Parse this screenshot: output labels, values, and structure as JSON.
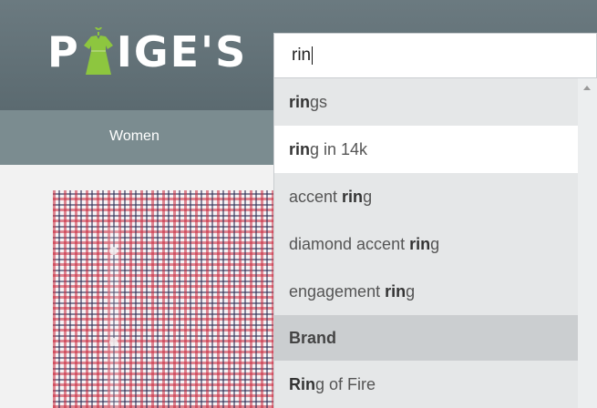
{
  "logo": {
    "prefix": "P",
    "suffix": "IGE'S"
  },
  "nav": {
    "items": [
      {
        "label": "Women"
      }
    ]
  },
  "search": {
    "value": "rin"
  },
  "dropdown": {
    "suggestions": [
      {
        "bold": "rin",
        "rest": "gs"
      },
      {
        "bold": "rin",
        "rest": "g in 14k"
      },
      {
        "pre": "accent ",
        "bold": "rin",
        "rest": "g"
      },
      {
        "pre": "diamond accent ",
        "bold": "rin",
        "rest": "g"
      },
      {
        "pre": "engagement ",
        "bold": "rin",
        "rest": "g"
      }
    ],
    "section_header": "Brand",
    "brand_suggestion": {
      "bold": "Rin",
      "rest": "g of Fire"
    }
  },
  "colors": {
    "header": "#5b6a70",
    "navbar": "#7b8c90",
    "logo_accent": "#8dc63f",
    "dropdown_bg": "#e5e7e8",
    "dropdown_highlight": "#ffffff",
    "section_header_bg": "#cbced0"
  },
  "icons": {
    "logo_letter_a": "dress-hanger-icon",
    "scroll_up": "scroll-up-arrow-icon"
  }
}
